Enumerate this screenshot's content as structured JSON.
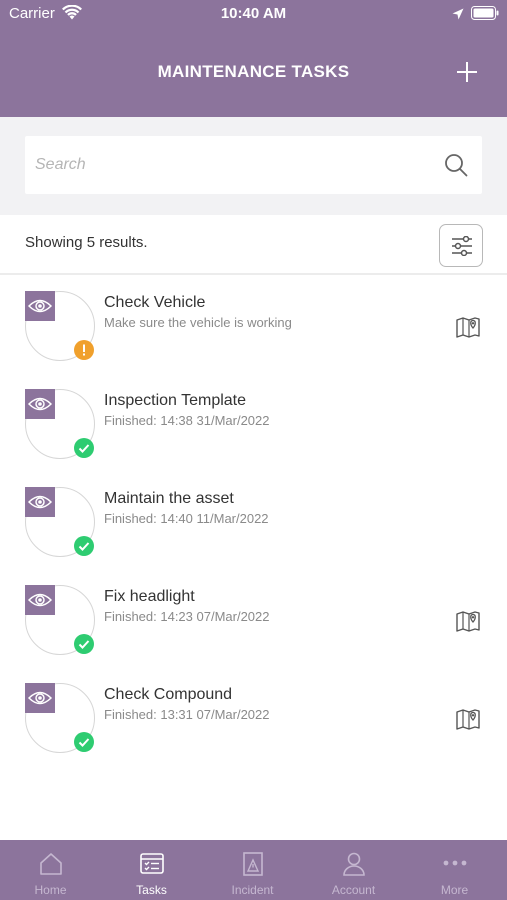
{
  "status_bar": {
    "carrier": "Carrier",
    "time": "10:40 AM"
  },
  "header": {
    "title": "MAINTENANCE TASKS",
    "add_icon": "plus-icon"
  },
  "search": {
    "placeholder": "Search",
    "value": "",
    "icon": "search-icon"
  },
  "results": {
    "summary": "Showing 5 results.",
    "filter_icon": "sliders-icon"
  },
  "colors": {
    "brand": "#8c749c",
    "warning": "#f0a02c",
    "success": "#2ecc71",
    "background_panel": "#f2f2f4"
  },
  "tasks": [
    {
      "title": "Check Vehicle",
      "subtitle": "Make sure the vehicle is working",
      "status": "warning",
      "has_map": true
    },
    {
      "title": "Inspection Template",
      "subtitle": "Finished: 14:38 31/Mar/2022",
      "status": "done",
      "has_map": false
    },
    {
      "title": "Maintain the asset",
      "subtitle": "Finished: 14:40 11/Mar/2022",
      "status": "done",
      "has_map": false
    },
    {
      "title": "Fix headlight",
      "subtitle": "Finished: 14:23 07/Mar/2022",
      "status": "done",
      "has_map": true
    },
    {
      "title": "Check Compound",
      "subtitle": "Finished: 13:31 07/Mar/2022",
      "status": "done",
      "has_map": true
    }
  ],
  "tab_bar": {
    "active": "Tasks",
    "tabs": [
      {
        "label": "Home",
        "icon": "home-icon"
      },
      {
        "label": "Tasks",
        "icon": "tasks-icon"
      },
      {
        "label": "Incident",
        "icon": "incident-icon"
      },
      {
        "label": "Account",
        "icon": "account-icon"
      },
      {
        "label": "More",
        "icon": "more-icon"
      }
    ]
  }
}
